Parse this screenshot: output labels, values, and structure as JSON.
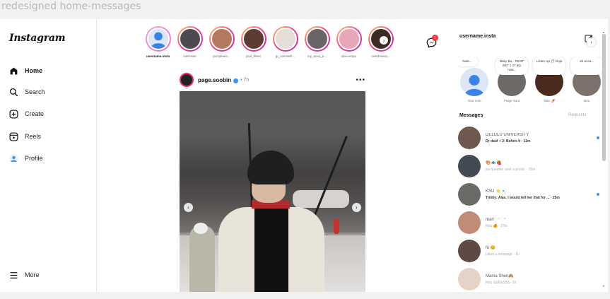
{
  "frame": {
    "title": "redesigned home-messages"
  },
  "sidebar": {
    "logo": "Instagram",
    "items": [
      {
        "label": "Home",
        "icon": "home-icon",
        "active": true
      },
      {
        "label": "Search",
        "icon": "search-icon"
      },
      {
        "label": "Create",
        "icon": "create-icon"
      },
      {
        "label": "Reels",
        "icon": "reels-icon"
      },
      {
        "label": "Profile",
        "icon": "profile-icon"
      }
    ],
    "more_label": "More"
  },
  "stories": [
    {
      "name": "username.insta",
      "me": true
    },
    {
      "name": "metrosan"
    },
    {
      "name": "jennyleam..."
    },
    {
      "name": "jisul_lilmei"
    },
    {
      "name": "jp_camnath..."
    },
    {
      "name": "my_aoos_a..."
    },
    {
      "name": "deucompo"
    },
    {
      "name": "noisdosess..."
    }
  ],
  "messenger_badge": "1",
  "post": {
    "username": "page.soobin",
    "time": "• 7h",
    "more": "•••"
  },
  "right_panel": {
    "username": "username.insta",
    "notes": [
      {
        "note": "Note...",
        "name": "Your note"
      },
      {
        "note": "Baby Ba... NEXT SET 1 27 dry now...",
        "name": "Paige Sout"
      },
      {
        "note": "Listen Up 🎵 Doja",
        "name": "Tako 🍠"
      },
      {
        "note": "ah ai ea...",
        "name": "tanu"
      }
    ],
    "messages_title": "Messages",
    "requests_label": "Requests",
    "messages": [
      {
        "name": "DELULU UNIVERSITY",
        "preview": "Dr dauf + 2: Before it · 11m",
        "unread": true
      },
      {
        "name": "🎨🐟🍓",
        "preview": "sis queeder sent a photo. · 19m",
        "unread": false
      },
      {
        "name": "KSU ⭐🔹",
        "preview": "Trinity: Alas, I would tell her that for ... · 25m",
        "unread": true
      },
      {
        "name": "marl ˙ ⁻ ˙ ⁺",
        "preview": "Nou 🍊 · 27m",
        "unread": false
      },
      {
        "name": "fo 😊",
        "preview": "Liked a message · 1h",
        "unread": false
      },
      {
        "name": "Mama Shen🙈",
        "preview": "Nou ΔΔΔΔΔΔΔ · 1h",
        "unread": false
      }
    ]
  }
}
